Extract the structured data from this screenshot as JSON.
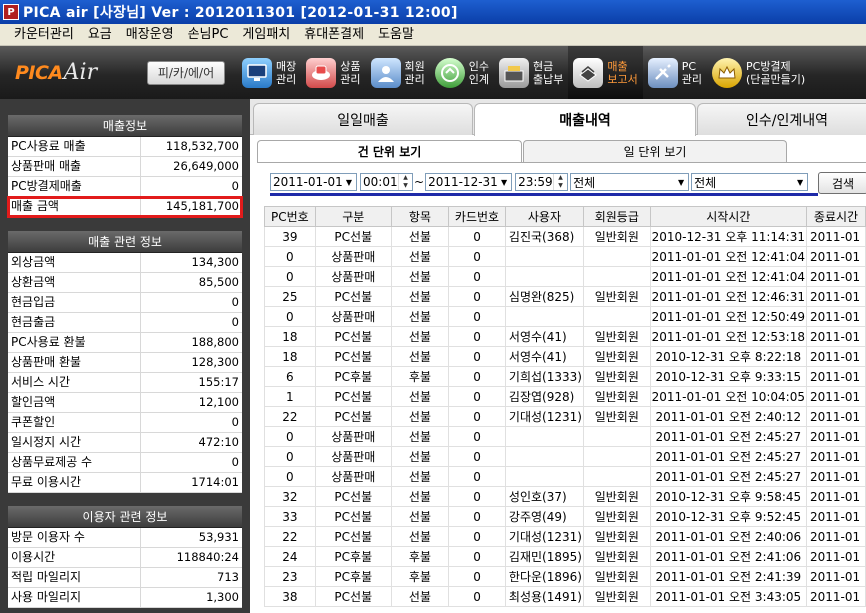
{
  "window": {
    "title": "PICA air [사장님]  Ver : 2012011301 [2012-01-31 12:00]",
    "icon_text": "P"
  },
  "menu": [
    "카운터관리",
    "요금",
    "매장운영",
    "손님PC",
    "게임패치",
    "휴대폰결제",
    "도움말"
  ],
  "toolbar": {
    "logo_pica": "PICA",
    "logo_air": "Air",
    "mode_label": "피/카/에/어",
    "tools": [
      {
        "label": "매장\n관리",
        "icon": "monitor-icon"
      },
      {
        "label": "상품\n관리",
        "icon": "food-icon"
      },
      {
        "label": "회원\n관리",
        "icon": "member-icon"
      },
      {
        "label": "인수\n인계",
        "icon": "handover-icon"
      },
      {
        "label": "현금\n출납부",
        "icon": "cash-register-icon"
      },
      {
        "label": "매출\n보고서",
        "icon": "report-icon"
      },
      {
        "label": "PC\n관리",
        "icon": "pc-tools-icon"
      },
      {
        "label": "PC방결제\n(단골만들기)",
        "icon": "crown-icon"
      }
    ]
  },
  "left": {
    "sales": {
      "title": "매출정보",
      "rows": [
        {
          "label": "PC사용료 매출",
          "value": "118,532,700"
        },
        {
          "label": "상품판매 매출",
          "value": "26,649,000"
        },
        {
          "label": "PC방결제매출",
          "value": "0"
        },
        {
          "label": "매출 금액",
          "value": "145,181,700"
        }
      ]
    },
    "related": {
      "title": "매출 관련 정보",
      "rows": [
        {
          "label": "외상금액",
          "value": "134,300"
        },
        {
          "label": "상환금액",
          "value": "85,500"
        },
        {
          "label": "현금입금",
          "value": "0"
        },
        {
          "label": "현금출금",
          "value": "0"
        },
        {
          "label": "PC사용료 환불",
          "value": "188,800"
        },
        {
          "label": "상품판매 환불",
          "value": "128,300"
        },
        {
          "label": "서비스 시간",
          "value": "155:17"
        },
        {
          "label": "할인금액",
          "value": "12,100"
        },
        {
          "label": "쿠폰할인",
          "value": "0"
        },
        {
          "label": "일시정지 시간",
          "value": "472:10"
        },
        {
          "label": "상품무료제공 수",
          "value": "0"
        },
        {
          "label": "무료 이용시간",
          "value": "1714:01"
        }
      ]
    },
    "users": {
      "title": "이용자 관련 정보",
      "rows": [
        {
          "label": "방문 이용자 수",
          "value": "53,931"
        },
        {
          "label": "이용시간",
          "value": "118840:24"
        },
        {
          "label": "적립 마일리지",
          "value": "713"
        },
        {
          "label": "사용 마일리지",
          "value": "1,300"
        }
      ]
    }
  },
  "tabs": [
    "일일매출",
    "매출내역",
    "인수/인계내역"
  ],
  "subtabs": [
    "건 단위 보기",
    "일 단위 보기"
  ],
  "filter": {
    "start_date": "2011-01-01",
    "start_time": "00:01",
    "tilde": "~",
    "end_date": "2011-12-31",
    "end_time": "23:59",
    "type_select": "전체",
    "type_select2": "전체",
    "search_label": "검색"
  },
  "table": {
    "columns": [
      "PC번호",
      "구분",
      "항목",
      "카드번호",
      "사용자",
      "회원등급",
      "시작시간",
      "종료시간"
    ],
    "rows": [
      [
        "39",
        "PC선불",
        "선불",
        "0",
        "김진국(368)",
        "일반회원",
        "2010-12-31 오후 11:14:31",
        "2011-01"
      ],
      [
        "0",
        "상품판매",
        "선불",
        "0",
        "",
        "",
        "2011-01-01 오전 12:41:04",
        "2011-01"
      ],
      [
        "0",
        "상품판매",
        "선불",
        "0",
        "",
        "",
        "2011-01-01 오전 12:41:04",
        "2011-01"
      ],
      [
        "25",
        "PC선불",
        "선불",
        "0",
        "심명완(825)",
        "일반회원",
        "2011-01-01 오전 12:46:31",
        "2011-01"
      ],
      [
        "0",
        "상품판매",
        "선불",
        "0",
        "",
        "",
        "2011-01-01 오전 12:50:49",
        "2011-01"
      ],
      [
        "18",
        "PC선불",
        "선불",
        "0",
        "서영수(41)",
        "일반회원",
        "2011-01-01 오전 12:53:18",
        "2011-01"
      ],
      [
        "18",
        "PC선불",
        "선불",
        "0",
        "서영수(41)",
        "일반회원",
        "2010-12-31 오후 8:22:18",
        "2011-01"
      ],
      [
        "6",
        "PC후불",
        "후불",
        "0",
        "기희섭(1333)",
        "일반회원",
        "2010-12-31 오후 9:33:15",
        "2011-01"
      ],
      [
        "1",
        "PC선불",
        "선불",
        "0",
        "김장엽(928)",
        "일반회원",
        "2011-01-01 오전 10:04:05",
        "2011-01"
      ],
      [
        "22",
        "PC선불",
        "선불",
        "0",
        "기대성(1231)",
        "일반회원",
        "2011-01-01 오전 2:40:12",
        "2011-01"
      ],
      [
        "0",
        "상품판매",
        "선불",
        "0",
        "",
        "",
        "2011-01-01 오전 2:45:27",
        "2011-01"
      ],
      [
        "0",
        "상품판매",
        "선불",
        "0",
        "",
        "",
        "2011-01-01 오전 2:45:27",
        "2011-01"
      ],
      [
        "0",
        "상품판매",
        "선불",
        "0",
        "",
        "",
        "2011-01-01 오전 2:45:27",
        "2011-01"
      ],
      [
        "32",
        "PC선불",
        "선불",
        "0",
        "성인호(37)",
        "일반회원",
        "2010-12-31 오후 9:58:45",
        "2011-01"
      ],
      [
        "33",
        "PC선불",
        "선불",
        "0",
        "강주영(49)",
        "일반회원",
        "2010-12-31 오후 9:52:45",
        "2011-01"
      ],
      [
        "22",
        "PC선불",
        "선불",
        "0",
        "기대성(1231)",
        "일반회원",
        "2011-01-01 오전 2:40:06",
        "2011-01"
      ],
      [
        "24",
        "PC후불",
        "후불",
        "0",
        "김재민(1895)",
        "일반회원",
        "2011-01-01 오전 2:41:06",
        "2011-01"
      ],
      [
        "23",
        "PC후불",
        "후불",
        "0",
        "한다운(1896)",
        "일반회원",
        "2011-01-01 오전 2:41:39",
        "2011-01"
      ],
      [
        "38",
        "PC선불",
        "선불",
        "0",
        "최성용(1491)",
        "일반회원",
        "2011-01-01 오전 3:43:05",
        "2011-01"
      ]
    ]
  }
}
